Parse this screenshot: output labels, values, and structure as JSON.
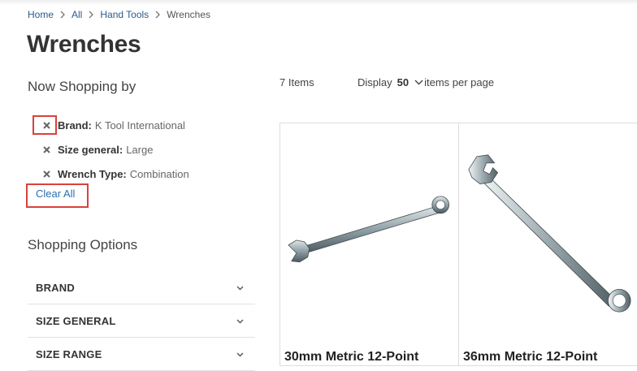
{
  "breadcrumb": {
    "items": [
      "Home",
      "All",
      "Hand Tools"
    ],
    "current": "Wrenches"
  },
  "page_title": "Wrenches",
  "now_shopping": {
    "heading": "Now Shopping by",
    "filters": [
      {
        "label": "Brand:",
        "value": "K Tool International"
      },
      {
        "label": "Size general:",
        "value": "Large"
      },
      {
        "label": "Wrench Type:",
        "value": "Combination"
      }
    ],
    "clear_all": "Clear All"
  },
  "shopping_options": {
    "heading": "Shopping Options",
    "items": [
      "BRAND",
      "SIZE GENERAL",
      "SIZE RANGE"
    ]
  },
  "toolbar": {
    "count": "7 Items",
    "display_label": "Display",
    "limit": "50",
    "per_page": "items per page"
  },
  "products": [
    {
      "name": "30mm Metric 12-Point"
    },
    {
      "name": "36mm Metric 12-Point"
    }
  ],
  "colors": {
    "link": "#2a6fb0",
    "highlight": "#d9413b"
  }
}
